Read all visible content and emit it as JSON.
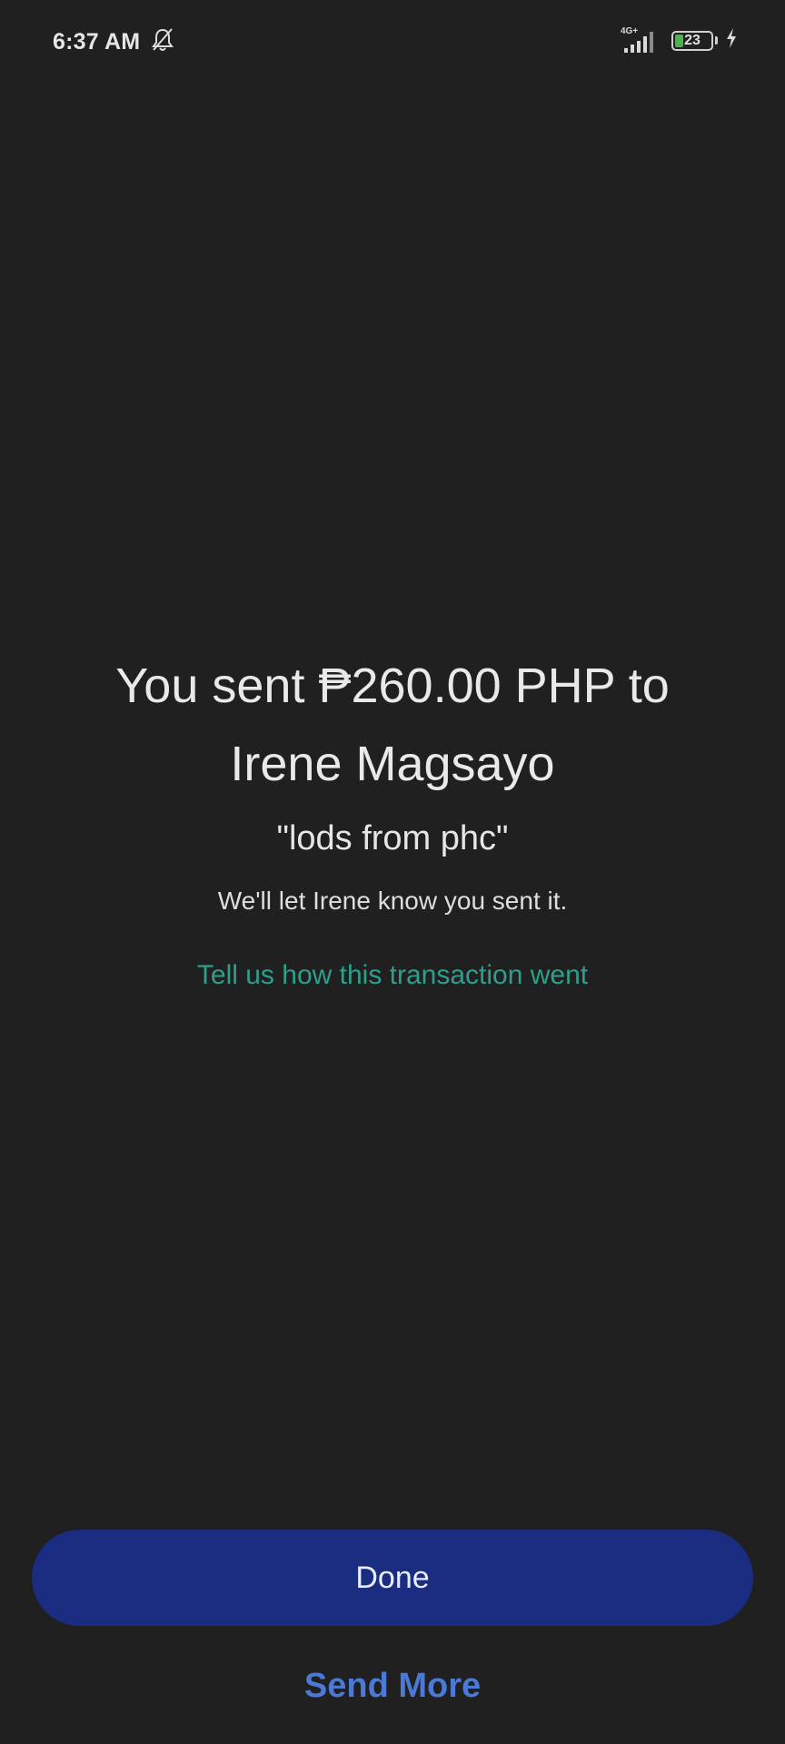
{
  "status_bar": {
    "time": "6:37 AM",
    "notification_icon": "bell-off-icon",
    "network_type": "4G+",
    "signal_icon": "signal-icon",
    "battery_level": "23",
    "battery_fill_fraction": 0.23,
    "charging_icon": "lightning-icon"
  },
  "confirmation": {
    "headline_line1": "You sent ₱260.00 PHP to",
    "headline_line2": "Irene  Magsayo",
    "note": "\"lods from phc\"",
    "notify_text": "We'll let Irene know you sent it.",
    "feedback_link": "Tell us how this transaction went"
  },
  "actions": {
    "done_label": "Done",
    "send_more_label": "Send More"
  },
  "colors": {
    "background": "#202020",
    "link_teal": "#2e9f8d",
    "primary_button": "#1a2d80",
    "secondary_link": "#4a7ad6"
  }
}
